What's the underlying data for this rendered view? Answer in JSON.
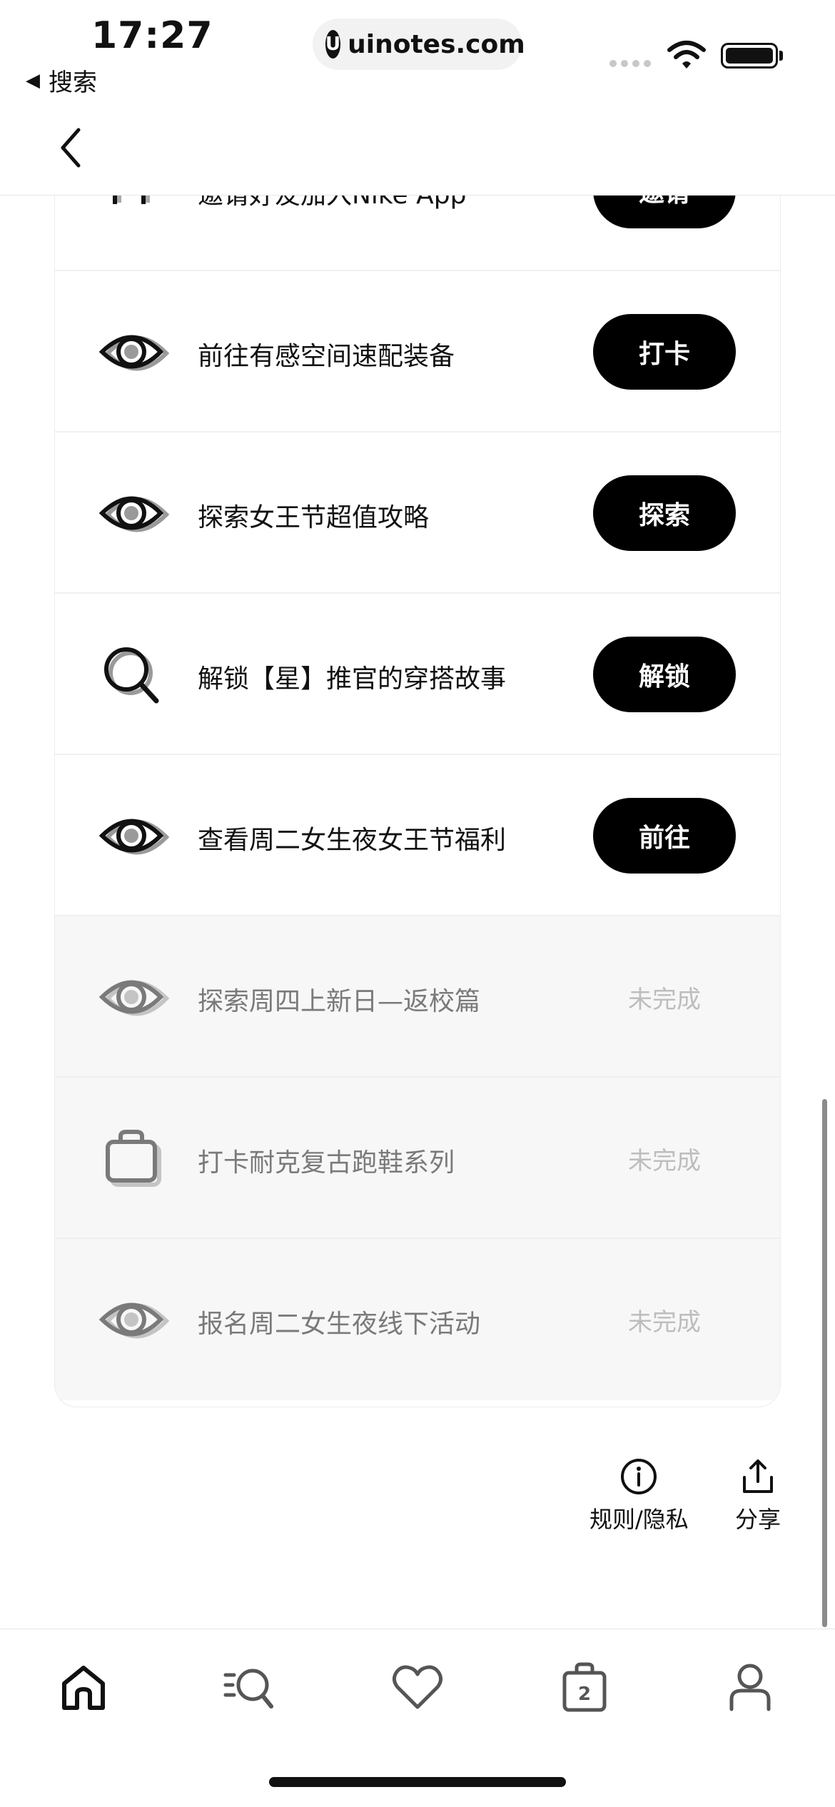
{
  "status_bar": {
    "time": "17:27",
    "back_app_label": "搜索",
    "url": "uinotes.com",
    "url_logo": "U"
  },
  "tasks": [
    {
      "icon": "person-icon",
      "label": "邀请好友加入Nike App",
      "action": "邀请",
      "state": "active"
    },
    {
      "icon": "eye-icon",
      "label": "前往有感空间速配装备",
      "action": "打卡",
      "state": "active"
    },
    {
      "icon": "eye-icon",
      "label": "探索女王节超值攻略",
      "action": "探索",
      "state": "active"
    },
    {
      "icon": "search-icon",
      "label": "解锁【星】推官的穿搭故事",
      "action": "解锁",
      "state": "active"
    },
    {
      "icon": "eye-icon",
      "label": "查看周二女生夜女王节福利",
      "action": "前往",
      "state": "active"
    },
    {
      "icon": "eye-icon",
      "label": "探索周四上新日—返校篇",
      "action": "未完成",
      "state": "incomplete"
    },
    {
      "icon": "bag-icon",
      "label": "打卡耐克复古跑鞋系列",
      "action": "未完成",
      "state": "incomplete"
    },
    {
      "icon": "eye-icon",
      "label": "报名周二女生夜线下活动",
      "action": "未完成",
      "state": "incomplete"
    }
  ],
  "footer": {
    "rules_label": "规则/隐私",
    "share_label": "分享"
  },
  "tab_bar": {
    "items": [
      {
        "name": "home",
        "icon": "home-icon"
      },
      {
        "name": "shop",
        "icon": "search-list-icon"
      },
      {
        "name": "favorites",
        "icon": "heart-icon"
      },
      {
        "name": "bag",
        "icon": "bag-icon",
        "count": "2"
      },
      {
        "name": "profile",
        "icon": "person-icon"
      }
    ]
  },
  "colors": {
    "primary_button": "#000000",
    "primary_button_text": "#ffffff",
    "incomplete_text": "#bdbdbd",
    "incomplete_row_bg": "#f7f7f7"
  }
}
